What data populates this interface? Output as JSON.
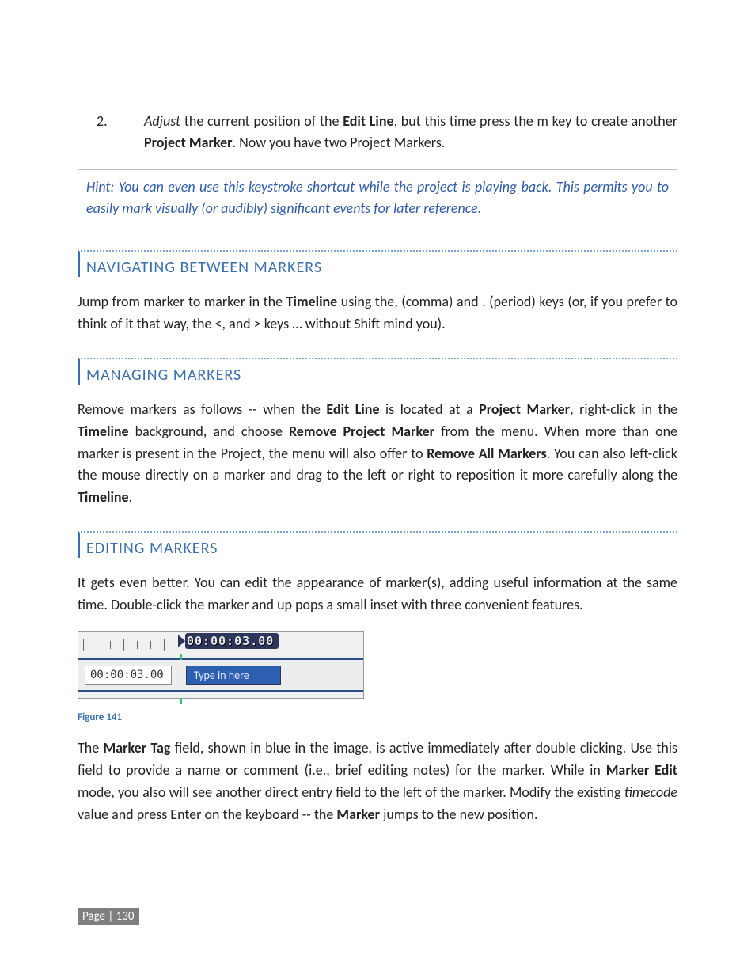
{
  "list": {
    "num": "2.",
    "item2_html": "<i>Adjust</i> the current position of the <b>Edit Line</b>, but this time press the m key to create another <b>Project Marker</b>.  Now you have two Project Markers."
  },
  "hint": "Hint: You can even use this keystroke shortcut while the project is playing back.  This permits you to easily mark visually (or audibly) significant events for later reference.",
  "sections": {
    "nav": {
      "title": "NAVIGATING BETWEEN MARKERS",
      "body_html": "Jump from marker to marker in the <b>Timeline</b> using the, (comma) and . (period) keys (or, if you prefer to think of it that way, the &lt;, and &gt; keys … without Shift mind you)."
    },
    "manage": {
      "title": "MANAGING MARKERS",
      "body_html": "Remove markers as follows -- when the <b>Edit Line</b> is located at a <b>Project Marker</b>, right-click in the <b>Timeline</b> background, and choose <b>Remove Project Marker</b> from the menu.  When more than one marker is present in the Project, the menu will also offer to <b>Remove All Markers</b>.  You can also left-click the mouse directly on a marker and drag to the left or right to reposition it more carefully along the <b>Timeline</b>."
    },
    "edit": {
      "title": "EDITING MARKERS",
      "body1_html": "It gets even better. You can edit the appearance of marker(s), adding useful information at the same time.  Double-click the marker and up pops a small inset with three convenient features.",
      "body2_html": "The <b>Marker Tag</b> field, shown in blue in the image, is active immediately after double clicking. Use this field to provide a name or comment (i.e., brief editing notes) for the marker. While in <b>Marker Edit</b> mode, you also will see another direct entry field to the left of the marker.  Modify the existing <i>timecode</i> value and press Enter on the keyboard -- the <b>Marker</b> jumps to the new position."
    }
  },
  "figure": {
    "label": "Figure 141",
    "pill_timecode": "00:00:03.00",
    "input_timecode": "00:00:03.00",
    "tag_placeholder": "Type in here"
  },
  "footer": "Page | 130"
}
